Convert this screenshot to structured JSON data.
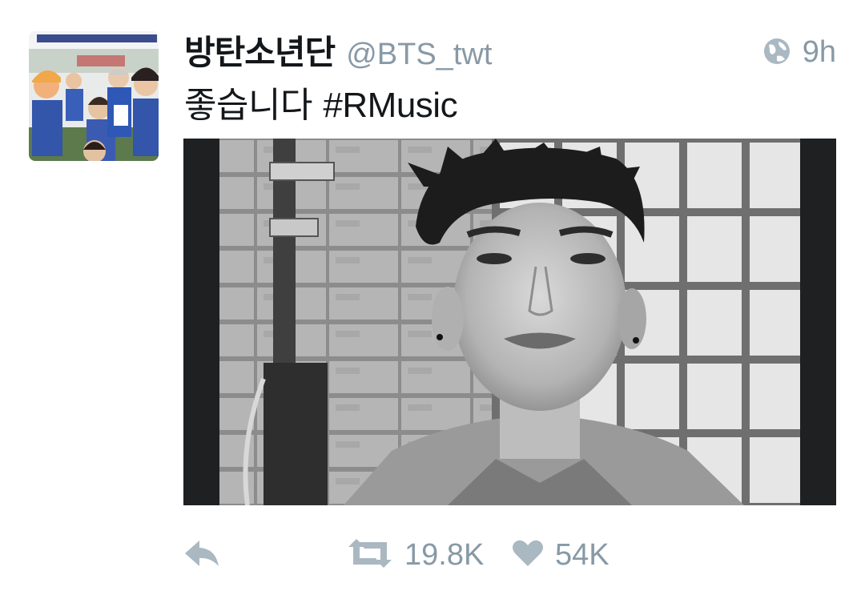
{
  "tweet": {
    "display_name": "방탄소년단",
    "handle": "@BTS_twt",
    "time": "9h",
    "text": "좋습니다",
    "hashtag": "#RMusic"
  },
  "icons": {
    "globe": "globe-icon",
    "reply": "reply-icon",
    "retweet": "retweet-icon",
    "like": "heart-icon"
  },
  "stats": {
    "retweets": "19.8K",
    "likes": "54K"
  },
  "colors": {
    "text": "#14171a",
    "muted": "#8899a6"
  }
}
